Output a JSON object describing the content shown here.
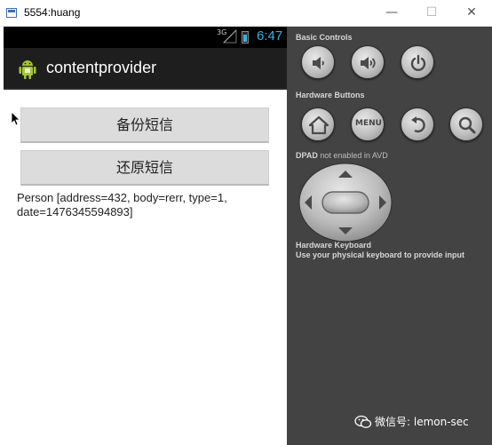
{
  "window": {
    "title": "5554:huang",
    "min_glyph": "—",
    "max_glyph": "☐",
    "close_glyph": "✕"
  },
  "status_bar": {
    "network": "3G",
    "time": "6:47"
  },
  "app": {
    "title": "contentprovider"
  },
  "buttons": {
    "backup": "备份短信",
    "restore": "还原短信"
  },
  "output_text": "Person [address=432, body=rerr, type=1, date=1476345594893]",
  "panel": {
    "basic_controls": "Basic Controls",
    "hardware_buttons": "Hardware Buttons",
    "menu_label": "MENU",
    "dpad_label": "DPAD",
    "dpad_note": "not enabled in AVD",
    "keyboard_title": "Hardware Keyboard",
    "keyboard_note": "Use your physical keyboard to provide input"
  },
  "watermark": "微信号: lemon-sec",
  "colors": {
    "accent": "#33b5e5",
    "panel_bg": "#434343",
    "button_bg": "#dcdcdc"
  },
  "icons": [
    "app-window-icon",
    "android-icon",
    "volume-down-icon",
    "volume-up-icon",
    "power-icon",
    "home-icon",
    "back-icon",
    "search-icon",
    "wechat-icon"
  ]
}
